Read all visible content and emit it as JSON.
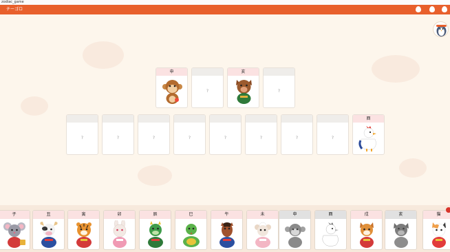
{
  "window": {
    "title": "zodiac_game"
  },
  "app": {
    "title": "チーゴロ"
  },
  "top_slots": [
    {
      "label": "申",
      "filled": true,
      "placeholder": "?"
    },
    {
      "label": "",
      "filled": false,
      "placeholder": "?"
    },
    {
      "label": "亥",
      "filled": true,
      "placeholder": "?"
    },
    {
      "label": "",
      "filled": false,
      "placeholder": "?"
    }
  ],
  "bottom_slots": [
    {
      "label": "",
      "filled": false,
      "placeholder": "?"
    },
    {
      "label": "",
      "filled": false,
      "placeholder": "?"
    },
    {
      "label": "",
      "filled": false,
      "placeholder": "?"
    },
    {
      "label": "",
      "filled": false,
      "placeholder": "?"
    },
    {
      "label": "",
      "filled": false,
      "placeholder": "?"
    },
    {
      "label": "",
      "filled": false,
      "placeholder": "?"
    },
    {
      "label": "",
      "filled": false,
      "placeholder": "?"
    },
    {
      "label": "",
      "filled": false,
      "placeholder": "?"
    },
    {
      "label": "酉",
      "filled": true,
      "placeholder": "?"
    }
  ],
  "tray_cards": [
    {
      "label": "子",
      "animal": "rat-icon",
      "used": false,
      "color": "#9a9aa6"
    },
    {
      "label": "丑",
      "animal": "ox-icon",
      "used": false,
      "color": "#4b4b4b"
    },
    {
      "label": "寅",
      "animal": "tiger-icon",
      "used": false,
      "color": "#e8922f"
    },
    {
      "label": "卯",
      "animal": "rabbit-icon",
      "used": false,
      "color": "#f3e9e4"
    },
    {
      "label": "辰",
      "animal": "dragon-icon",
      "used": false,
      "color": "#3f9c4a"
    },
    {
      "label": "巳",
      "animal": "snake-icon",
      "used": false,
      "color": "#5bb24a"
    },
    {
      "label": "午",
      "animal": "horse-icon",
      "used": false,
      "color": "#a0522d"
    },
    {
      "label": "未",
      "animal": "sheep-icon",
      "used": false,
      "color": "#f1e6dc"
    },
    {
      "label": "申",
      "animal": "monkey-icon",
      "used": true,
      "color": "#b36b2e"
    },
    {
      "label": "酉",
      "animal": "rooster-icon",
      "used": true,
      "color": "#ffffff"
    },
    {
      "label": "戌",
      "animal": "dog-icon",
      "used": false,
      "color": "#e0903a"
    },
    {
      "label": "亥",
      "animal": "boar-icon",
      "used": true,
      "color": "#9b5a2e"
    },
    {
      "label": "猫",
      "animal": "cat-icon",
      "used": false,
      "color": "#f0a04b"
    }
  ],
  "colors": {
    "accent": "#e8602c",
    "background": "#fdf6ec",
    "card_head": "#fbe2e2",
    "used_head": "#e1e1e1"
  }
}
